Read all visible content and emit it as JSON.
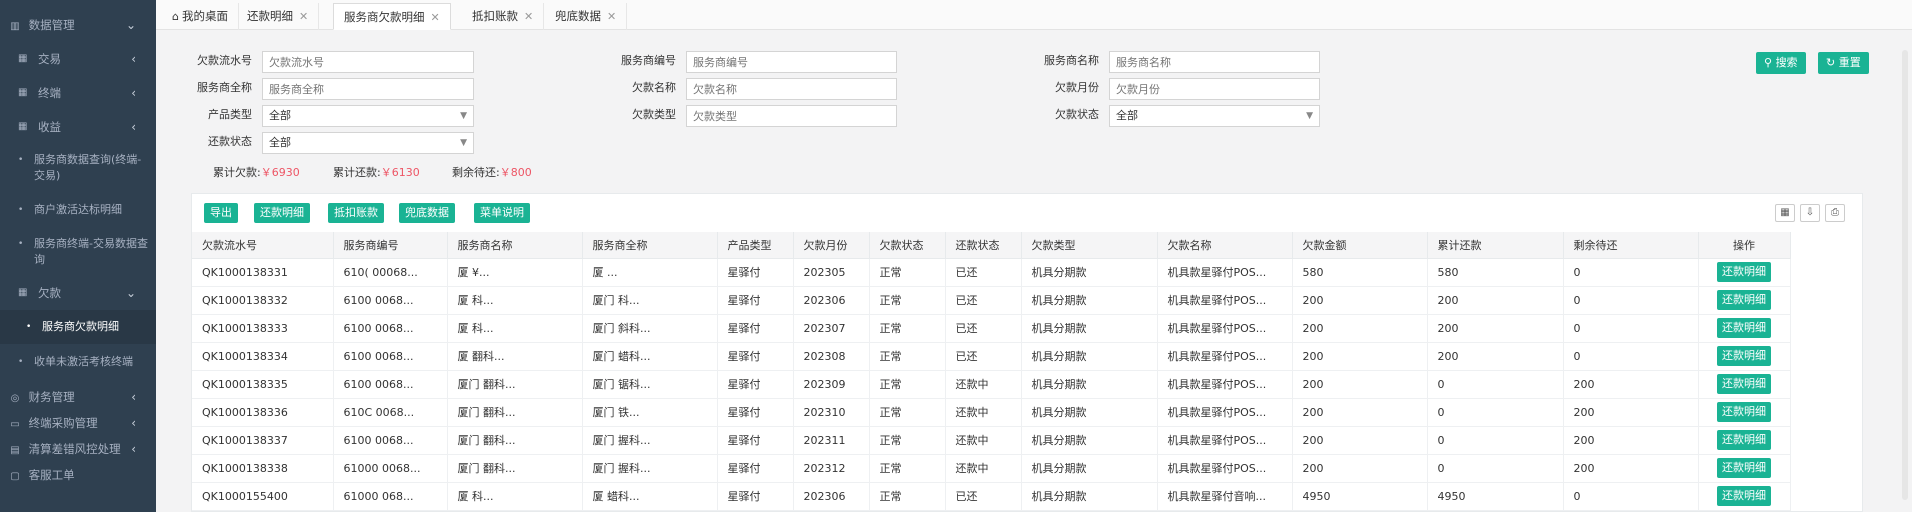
{
  "sidebar": {
    "items": [
      {
        "label": "数据管理",
        "icon": "database-icon"
      },
      {
        "label": "交易",
        "icon": "grid-icon"
      },
      {
        "label": "终端",
        "icon": "grid-icon"
      },
      {
        "label": "收益",
        "icon": "grid-icon"
      },
      {
        "label": "服务商数据查询(终端-交易)"
      },
      {
        "label": "商户激活达标明细"
      },
      {
        "label": "服务商终端-交易数据查询"
      },
      {
        "label": "欠款",
        "icon": "grid-icon"
      },
      {
        "label": "服务商欠款明细"
      },
      {
        "label": "收单未激活考核终端"
      },
      {
        "label": "财务管理",
        "icon": "finance-icon"
      },
      {
        "label": "终端采购管理",
        "icon": "purchase-icon"
      },
      {
        "label": "清算差错风控处理",
        "icon": "risk-icon"
      },
      {
        "label": "客服工单",
        "icon": "ticket-icon"
      }
    ]
  },
  "tabs": [
    {
      "label": "我的桌面"
    },
    {
      "label": "还款明细"
    },
    {
      "label": "服务商欠款明细"
    },
    {
      "label": "抵扣账款"
    },
    {
      "label": "兜底数据"
    }
  ],
  "search": {
    "fields": [
      {
        "label": "欠款流水号",
        "placeholder": "欠款流水号"
      },
      {
        "label": "服务商编号",
        "placeholder": "服务商编号"
      },
      {
        "label": "服务商名称",
        "placeholder": "服务商名称"
      },
      {
        "label": "服务商全称",
        "placeholder": "服务商全称"
      },
      {
        "label": "欠款名称",
        "placeholder": "欠款名称"
      },
      {
        "label": "欠款月份",
        "placeholder": "欠款月份"
      },
      {
        "label": "产品类型",
        "value": "全部"
      },
      {
        "label": "欠款类型",
        "placeholder": "欠款类型"
      },
      {
        "label": "欠款状态",
        "value": "全部"
      },
      {
        "label": "还款状态",
        "value": "全部"
      }
    ],
    "search_btn": "搜索",
    "reset_btn": "重置"
  },
  "totals": {
    "debt_label": "累计欠款:",
    "debt_value": "￥6930",
    "repaid_label": "累计还款:",
    "repaid_value": "￥6130",
    "remaining_label": "剩余待还:",
    "remaining_value": "￥800"
  },
  "actions": {
    "export": "导出",
    "repay_detail": "还款明细",
    "deduct": "抵扣账款",
    "fallback": "兜底数据",
    "menu_help": "菜单说明"
  },
  "table": {
    "headers": [
      "欠款流水号",
      "服务商编号",
      "服务商名称",
      "服务商全称",
      "产品类型",
      "欠款月份",
      "欠款状态",
      "还款状态",
      "欠款类型",
      "欠款名称",
      "欠款金额",
      "累计还款",
      "剩余待还",
      "操作"
    ],
    "row_button": "还款明细",
    "rows": [
      [
        "QK1000138331",
        "610( 00068...",
        "厦      ¥...",
        "厦          ...",
        "星驿付",
        "202305",
        "正常",
        "已还",
        "机具分期款",
        "机具款星驿付POS...",
        "580",
        "580",
        "0"
      ],
      [
        "QK1000138332",
        "6100 0068...",
        "厦      科...",
        "厦门       科...",
        "星驿付",
        "202306",
        "正常",
        "已还",
        "机具分期款",
        "机具款星驿付POS...",
        "200",
        "200",
        "0"
      ],
      [
        "QK1000138333",
        "6100   0068...",
        "厦      科...",
        "厦门      斜科...",
        "星驿付",
        "202307",
        "正常",
        "已还",
        "机具分期款",
        "机具款星驿付POS...",
        "200",
        "200",
        "0"
      ],
      [
        "QK1000138334",
        "6100   0068...",
        "厦      翻科...",
        "厦门     蜡科...",
        "星驿付",
        "202308",
        "正常",
        "已还",
        "机具分期款",
        "机具款星驿付POS...",
        "200",
        "200",
        "0"
      ],
      [
        "QK1000138335",
        "6100   0068...",
        "厦门     翻科...",
        "厦门     锯科...",
        "星驿付",
        "202309",
        "正常",
        "还款中",
        "机具分期款",
        "机具款星驿付POS...",
        "200",
        "0",
        "200"
      ],
      [
        "QK1000138336",
        "610C   0068...",
        "厦门     翻科...",
        "厦门    铁...",
        "星驿付",
        "202310",
        "正常",
        "还款中",
        "机具分期款",
        "机具款星驿付POS...",
        "200",
        "0",
        "200"
      ],
      [
        "QK1000138337",
        "6100   0068...",
        "厦门     翻科...",
        "厦门     握科...",
        "星驿付",
        "202311",
        "正常",
        "还款中",
        "机具分期款",
        "机具款星驿付POS...",
        "200",
        "0",
        "200"
      ],
      [
        "QK1000138338",
        "61000  0068...",
        "厦门     翻科...",
        "厦门     握科...",
        "星驿付",
        "202312",
        "正常",
        "还款中",
        "机具分期款",
        "机具款星驿付POS...",
        "200",
        "0",
        "200"
      ],
      [
        "QK1000155400",
        "61000  068...",
        "厦      科...",
        "厦     蜡科...",
        "星驿付",
        "202306",
        "正常",
        "已还",
        "机具分期款",
        "机具款星驿付音响...",
        "4950",
        "4950",
        "0"
      ]
    ]
  }
}
